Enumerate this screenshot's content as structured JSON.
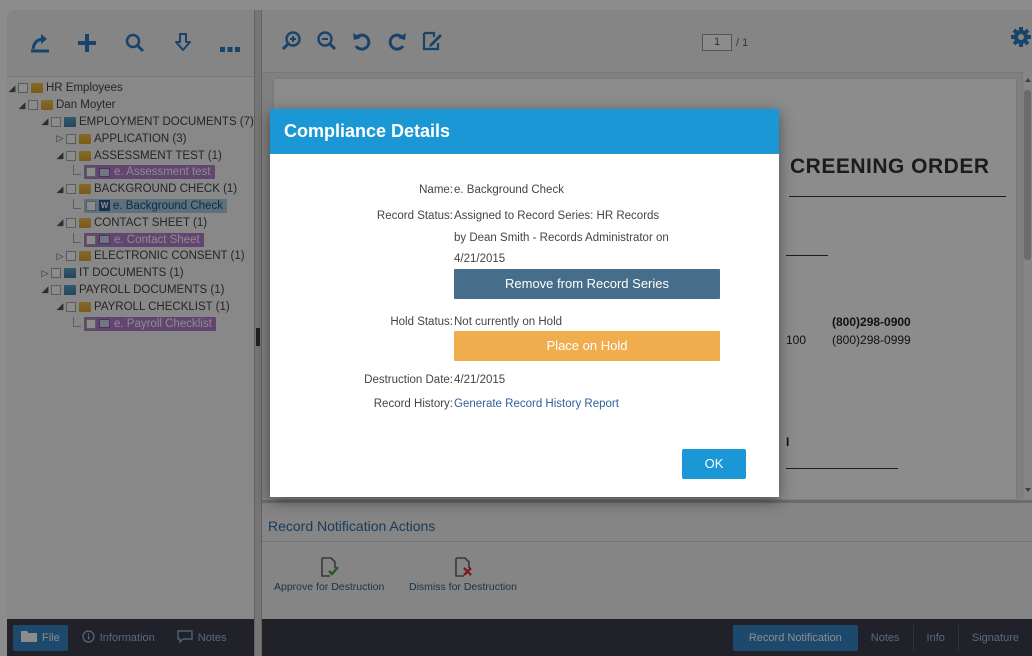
{
  "left_toolbar": {
    "icons": [
      "share-icon",
      "add-icon",
      "search-icon",
      "download-icon",
      "more-icon"
    ],
    "more_label": "..."
  },
  "tree": {
    "root": "HR Employees",
    "employee": "Dan Moyter",
    "nodes": [
      {
        "label": "EMPLOYMENT DOCUMENTS (7)"
      },
      {
        "label": "APPLICATION (3)"
      },
      {
        "label": "ASSESSMENT TEST (1)"
      },
      {
        "label": "e. Assessment test"
      },
      {
        "label": "BACKGROUND CHECK (1)"
      },
      {
        "label": "e. Background Check"
      },
      {
        "label": "CONTACT SHEET (1)"
      },
      {
        "label": "e. Contact Sheet"
      },
      {
        "label": "ELECTRONIC CONSENT (1)"
      },
      {
        "label": "IT DOCUMENTS (1)"
      },
      {
        "label": "PAYROLL DOCUMENTS (1)"
      },
      {
        "label": "PAYROLL CHECKLIST (1)"
      },
      {
        "label": "e. Payroll Checklist"
      }
    ]
  },
  "left_bottom": {
    "tabs": [
      {
        "label": "File",
        "icon": "file-icon",
        "active": true
      },
      {
        "label": "Information",
        "icon": "info-icon",
        "active": false
      },
      {
        "label": "Notes",
        "icon": "notes-icon",
        "active": false
      }
    ]
  },
  "viewer_toolbar": {
    "icons": [
      "zoom-in-icon",
      "zoom-out-icon",
      "rotate-left-icon",
      "rotate-right-icon",
      "edit-icon"
    ],
    "page_current": "1",
    "page_total": "/ 1",
    "settings_icon": "gear-icon"
  },
  "document": {
    "title_fragment": "CREENING ORDER",
    "phone1": "(800)298-0900",
    "phone2": "(800)298-0999",
    "partial_number": "100",
    "partial_mark": "I"
  },
  "notification": {
    "title": "Record Notification Actions",
    "actions": [
      {
        "label": "Approve for Destruction",
        "icon": "approve-document-icon"
      },
      {
        "label": "Dismiss for Destruction",
        "icon": "dismiss-document-icon"
      }
    ]
  },
  "right_bottom": {
    "tabs": [
      {
        "label": "Record Notification",
        "active": true
      },
      {
        "label": "Notes",
        "active": false
      },
      {
        "label": "Info",
        "active": false
      },
      {
        "label": "Signature",
        "active": false
      }
    ]
  },
  "modal": {
    "title": "Compliance Details",
    "name_label": "Name:",
    "name_value": "e. Background Check",
    "status_label": "Record Status:",
    "status_line1": "Assigned to Record Series: HR Records",
    "status_line2": "by Dean Smith - Records Administrator on",
    "status_line3": "4/21/2015",
    "remove_button": "Remove from Record Series",
    "hold_label": "Hold Status:",
    "hold_value": "Not currently on Hold",
    "hold_button": "Place on Hold",
    "destruction_label": "Destruction Date:",
    "destruction_value": "4/21/2015",
    "history_label": "Record History:",
    "history_link": "Generate Record History Report",
    "ok_button": "OK"
  },
  "colors": {
    "modal_header": "#1a97d4",
    "remove_button": "#466e8b",
    "hold_button": "#f0ad4e",
    "ok_button": "#1a97d4",
    "bottom_bar": "#3c3d4e",
    "active_tab": "#3585c6",
    "tree_highlight_purple": "#b27fce",
    "tree_highlight_blue": "#a9cde6"
  }
}
